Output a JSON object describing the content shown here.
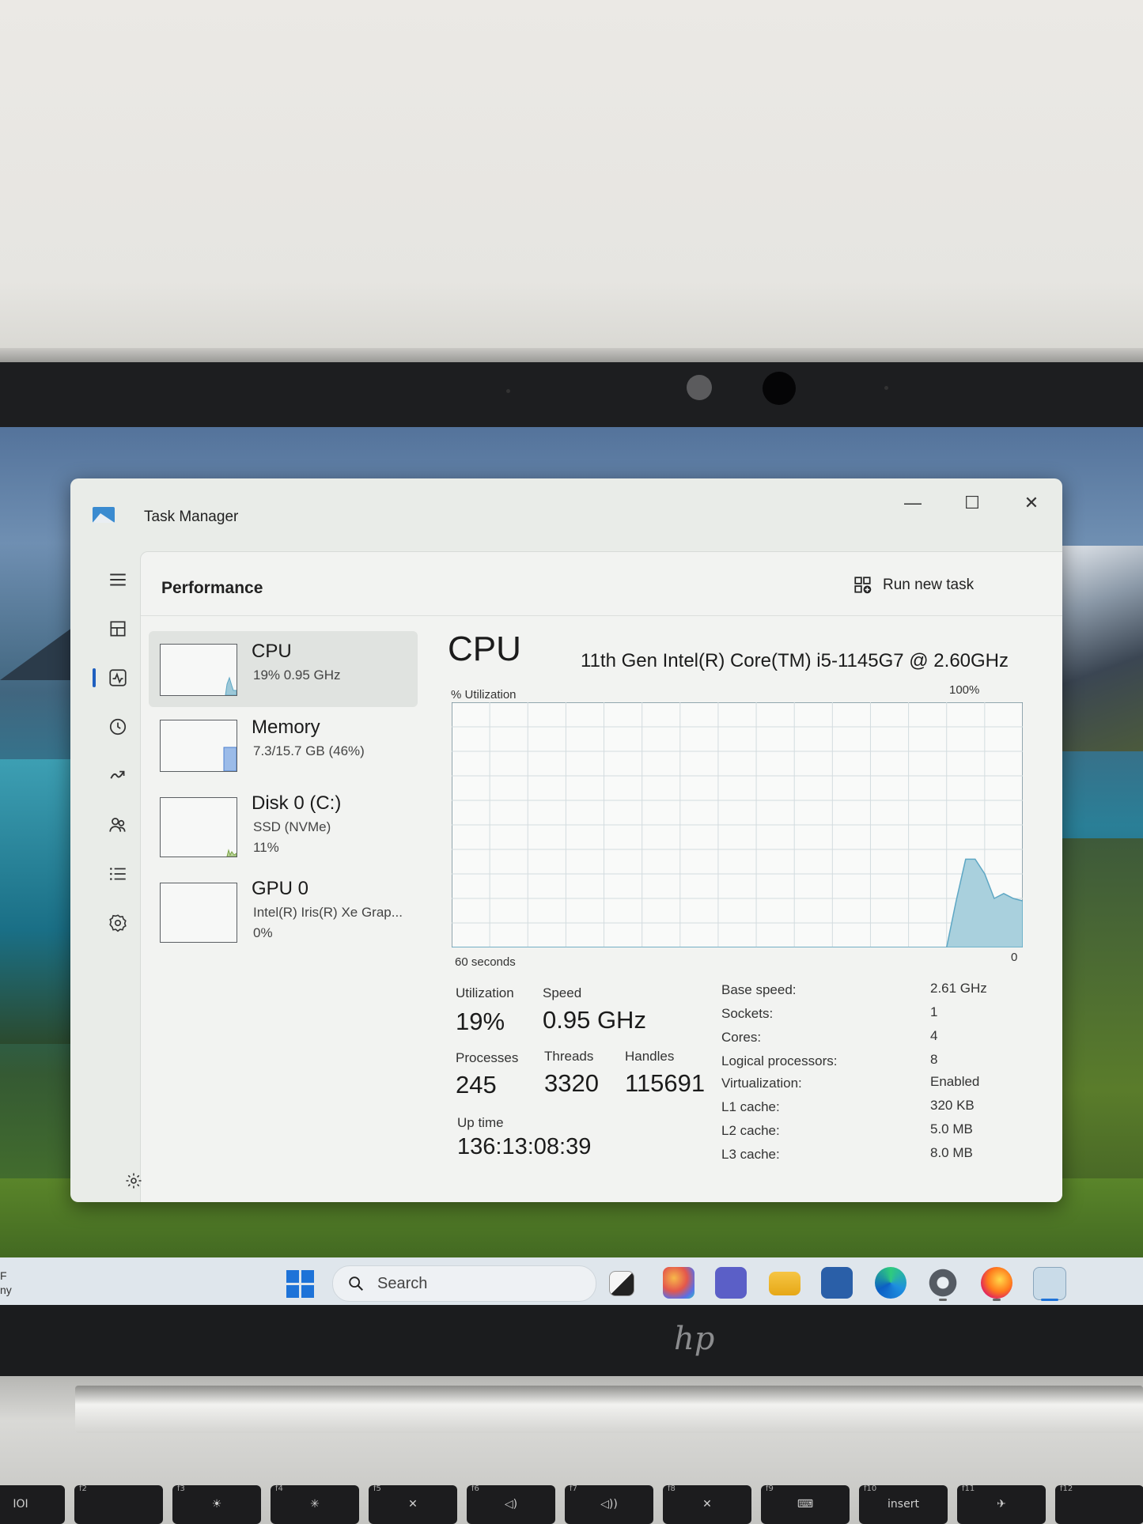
{
  "window": {
    "title": "Task Manager",
    "minimize_glyph": "—",
    "maximize_glyph": "☐",
    "close_glyph": "✕"
  },
  "header": {
    "page_title": "Performance",
    "run_new_task_label": "Run new task",
    "more_glyph": "···"
  },
  "nav_icons": [
    "hamburger-menu-icon",
    "processes-icon",
    "performance-icon",
    "app-history-icon",
    "startup-apps-icon",
    "users-icon",
    "details-icon",
    "services-icon",
    "settings-icon"
  ],
  "devices": [
    {
      "name": "CPU",
      "sub": "19%  0.95 GHz",
      "sub2": ""
    },
    {
      "name": "Memory",
      "sub": "7.3/15.7 GB (46%)",
      "sub2": ""
    },
    {
      "name": "Disk 0 (C:)",
      "sub": "SSD (NVMe)",
      "sub2": "11%"
    },
    {
      "name": "GPU 0",
      "sub": "Intel(R) Iris(R) Xe Grap...",
      "sub2": "0%"
    }
  ],
  "cpu": {
    "title": "CPU",
    "model": "11th Gen Intel(R) Core(TM) i5-1145G7 @ 2.60GHz",
    "util_label": "% Utilization",
    "max_label": "100%",
    "time_label": "60 seconds",
    "zero_label": "0",
    "stats": {
      "utilization_label": "Utilization",
      "utilization_value": "19%",
      "speed_label": "Speed",
      "speed_value": "0.95 GHz",
      "processes_label": "Processes",
      "processes_value": "245",
      "threads_label": "Threads",
      "threads_value": "3320",
      "handles_label": "Handles",
      "handles_value": "115691",
      "uptime_label": "Up time",
      "uptime_value": "136:13:08:39"
    },
    "specs": [
      {
        "key": "Base speed:",
        "value": "2.61 GHz"
      },
      {
        "key": "Sockets:",
        "value": "1"
      },
      {
        "key": "Cores:",
        "value": "4"
      },
      {
        "key": "Logical processors:",
        "value": "8"
      },
      {
        "key": "Virtualization:",
        "value": "Enabled"
      },
      {
        "key": "L1 cache:",
        "value": "320 KB"
      },
      {
        "key": "L2 cache:",
        "value": "5.0 MB"
      },
      {
        "key": "L3 cache:",
        "value": "8.0 MB"
      }
    ],
    "usage_history_percent": [
      0,
      0,
      0,
      0,
      0,
      0,
      0,
      0,
      0,
      0,
      0,
      0,
      0,
      0,
      0,
      0,
      0,
      0,
      0,
      0,
      0,
      0,
      0,
      0,
      0,
      0,
      0,
      0,
      0,
      0,
      0,
      0,
      0,
      0,
      0,
      0,
      0,
      0,
      0,
      0,
      0,
      0,
      0,
      0,
      0,
      0,
      0,
      0,
      0,
      0,
      0,
      0,
      0,
      19,
      36,
      36,
      30,
      20,
      22,
      20,
      19
    ],
    "accent_color": "#5ea7c4"
  },
  "taskbar": {
    "left_text_1": "F",
    "left_text_2": "ny",
    "search_placeholder": "Search",
    "icons": [
      "start-icon",
      "task-view-icon",
      "copilot-icon",
      "teams-icon",
      "file-explorer-icon",
      "store-icon",
      "edge-icon",
      "settings-app-icon",
      "firefox-icon",
      "task-manager-icon"
    ]
  },
  "laptop": {
    "logo": "hp",
    "keys": [
      {
        "fn": "f1",
        "label": "IOI"
      },
      {
        "fn": "f2",
        "label": ""
      },
      {
        "fn": "f3",
        "label": "☀"
      },
      {
        "fn": "f4",
        "label": "✳"
      },
      {
        "fn": "f5",
        "label": "✕"
      },
      {
        "fn": "f6",
        "label": "◁)"
      },
      {
        "fn": "f7",
        "label": "◁))"
      },
      {
        "fn": "f8",
        "label": "✕"
      },
      {
        "fn": "f9",
        "label": "⌨"
      },
      {
        "fn": "f10",
        "label": "insert"
      },
      {
        "fn": "f11",
        "label": "✈"
      },
      {
        "fn": "f12",
        "label": ""
      }
    ]
  }
}
